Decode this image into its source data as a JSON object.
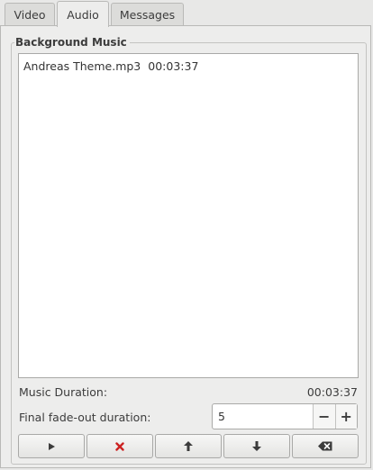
{
  "tabs": [
    {
      "label": "Video"
    },
    {
      "label": "Audio"
    },
    {
      "label": "Messages"
    }
  ],
  "background_music": {
    "legend": "Background Music",
    "items": [
      {
        "name": "Andreas Theme.mp3",
        "duration": "00:03:37"
      }
    ]
  },
  "music_duration": {
    "label": "Music Duration:",
    "value": "00:03:37"
  },
  "fade_out": {
    "label": "Final fade-out duration:",
    "value": "5",
    "decrement": "−",
    "increment": "+"
  },
  "toolbar": {
    "icons": [
      "play-icon",
      "remove-icon",
      "move-up-icon",
      "move-down-icon",
      "clear-icon"
    ],
    "colors": {
      "remove": "#cc2222",
      "icon": "#3c3c3c"
    }
  }
}
